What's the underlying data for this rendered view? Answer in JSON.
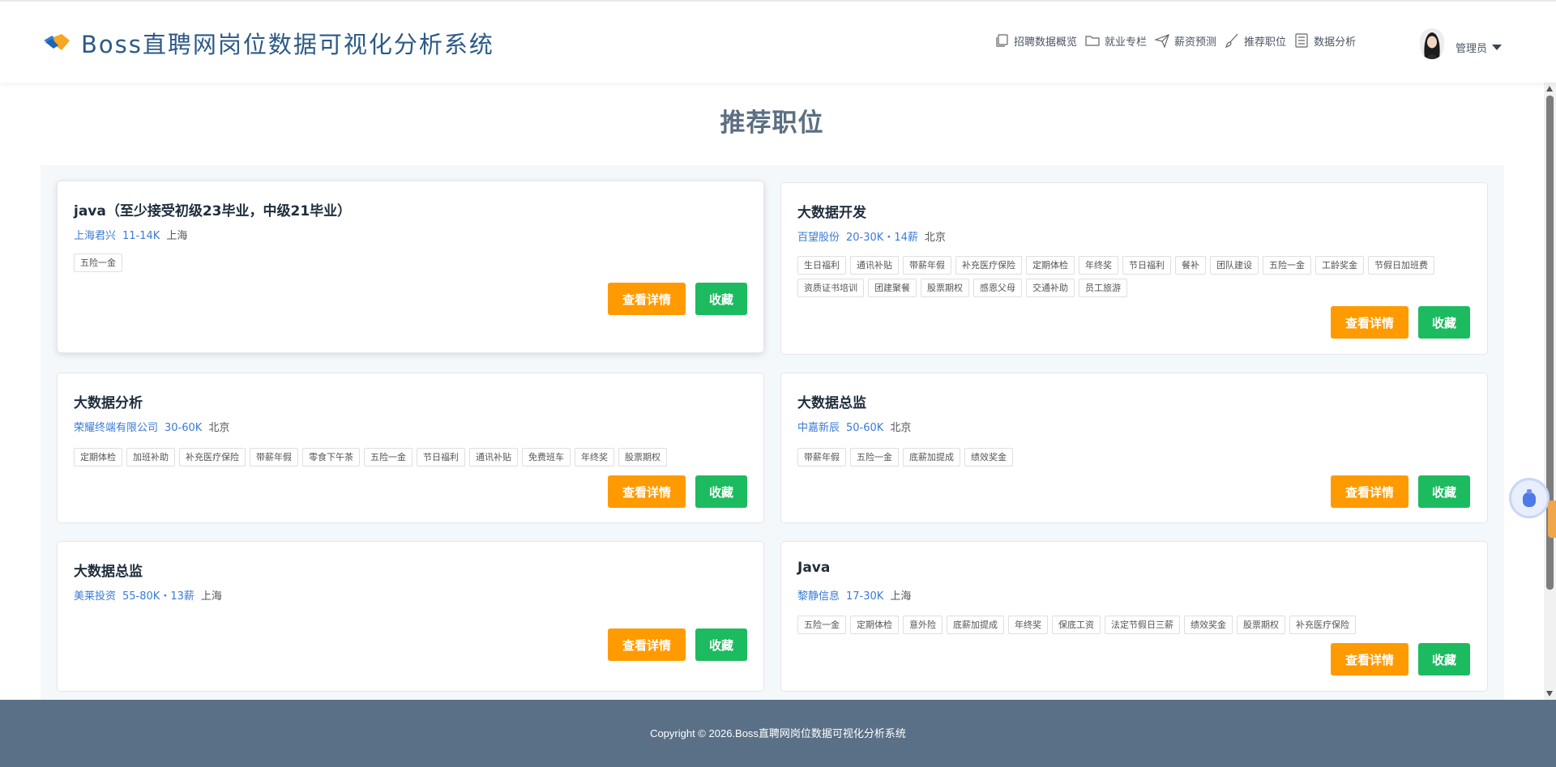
{
  "header": {
    "title": "Boss直聘网岗位数据可视化分析系统",
    "nav": [
      {
        "label": "招聘数据概览",
        "icon": "copy-icon"
      },
      {
        "label": "就业专栏",
        "icon": "folder-icon"
      },
      {
        "label": "薪资预测",
        "icon": "send-icon"
      },
      {
        "label": "推荐职位",
        "icon": "brush-icon"
      },
      {
        "label": "数据分析",
        "icon": "list-icon"
      }
    ],
    "user": "管理员"
  },
  "page_title": "推荐职位",
  "buttons": {
    "detail": "查看详情",
    "favorite": "收藏"
  },
  "jobs": [
    {
      "title": "java（至少接受初级23毕业，中级21毕业）",
      "company": "上海君兴",
      "salary": "11-14K",
      "city": "上海",
      "tags": [
        "五险一金"
      ]
    },
    {
      "title": "大数据开发",
      "company": "百望股份",
      "salary": "20-30K・14薪",
      "city": "北京",
      "tags": [
        "生日福利",
        "通讯补贴",
        "带薪年假",
        "补充医疗保险",
        "定期体检",
        "年终奖",
        "节日福利",
        "餐补",
        "团队建设",
        "五险一金",
        "工龄奖金",
        "节假日加班费",
        "资质证书培训",
        "团建聚餐",
        "股票期权",
        "感恩父母",
        "交通补助",
        "员工旅游"
      ]
    },
    {
      "title": "大数据分析",
      "company": "荣耀终端有限公司",
      "salary": "30-60K",
      "city": "北京",
      "tags": [
        "定期体检",
        "加班补助",
        "补充医疗保险",
        "带薪年假",
        "零食下午茶",
        "五险一金",
        "节日福利",
        "通讯补贴",
        "免费班车",
        "年终奖",
        "股票期权"
      ]
    },
    {
      "title": "大数据总监",
      "company": "中嘉新辰",
      "salary": "50-60K",
      "city": "北京",
      "tags": [
        "带薪年假",
        "五险一金",
        "底薪加提成",
        "绩效奖金"
      ]
    },
    {
      "title": "大数据总监",
      "company": "美莱投资",
      "salary": "55-80K・13薪",
      "city": "上海",
      "tags": []
    },
    {
      "title": "Java",
      "company": "黎静信息",
      "salary": "17-30K",
      "city": "上海",
      "tags": [
        "五险一金",
        "定期体检",
        "意外险",
        "底薪加提成",
        "年终奖",
        "保底工资",
        "法定节假日三薪",
        "绩效奖金",
        "股票期权",
        "补充医疗保险"
      ]
    }
  ],
  "footer": "Copyright © 2026.Boss直聘网岗位数据可视化分析系统",
  "colors": {
    "brand": "#2c5a86",
    "detail_button": "#ff9a00",
    "favorite_button": "#1cbb5f",
    "footer_bg": "#5a7087",
    "link": "#3a7bd5"
  }
}
